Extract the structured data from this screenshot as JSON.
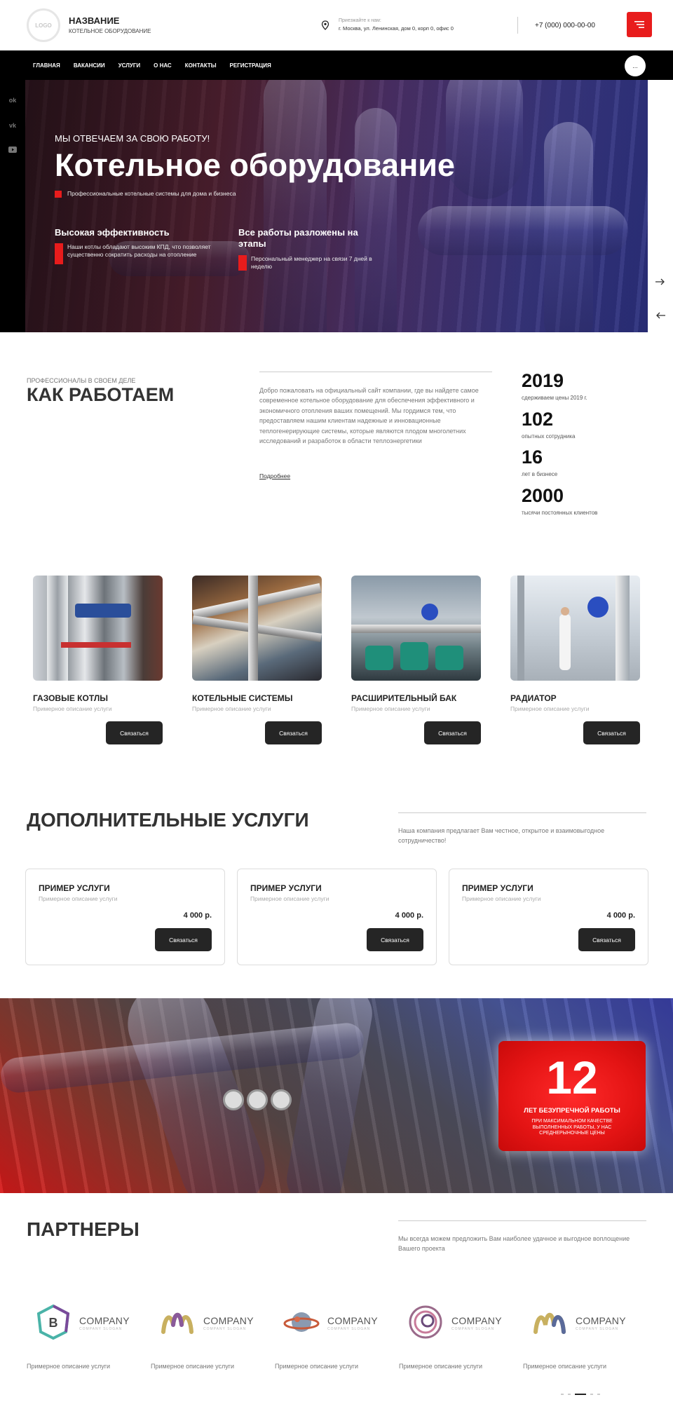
{
  "header": {
    "logo_text": "LOGO",
    "brand_name": "НАЗВАНИЕ",
    "brand_sub": "КОТЕЛЬНОЕ ОБОРУДОВАНИЕ",
    "address_label": "Приезжайте к нам:",
    "address_value": "г. Москва, ул. Ленинская, дом 0, корп 0, офис 0",
    "phone": "+7 (000) 000-00-00"
  },
  "nav": {
    "items": [
      "ГЛАВНАЯ",
      "ВАКАНСИИ",
      "УСЛУГИ",
      "О НАС",
      "КОНТАКТЫ",
      "РЕГИСТРАЦИЯ"
    ],
    "more": "..."
  },
  "social": [
    "ok",
    "vk",
    "youtube"
  ],
  "hero": {
    "tagline": "МЫ ОТВЕЧАЕМ ЗА СВОЮ РАБОТУ!",
    "title": "Котельное оборудование",
    "subtitle": "Профессиональные котельные системы для дома и бизнеса",
    "features": [
      {
        "title": "Высокая эффективность",
        "text": "Наши котлы обладают высоким КПД, что позволяет существенно сократить расходы на отопление"
      },
      {
        "title": "Все работы разложены на этапы",
        "text": "Персональный менеджер на связи 7 дней в неделю"
      }
    ]
  },
  "how": {
    "kicker": "ПРОФЕССИОНАЛЫ В СВОЕМ ДЕЛЕ",
    "title": "КАК РАБОТАЕМ",
    "text": "Добро пожаловать на официальный сайт компании, где вы найдете самое современное котельное оборудование для обеспечения эффективного и экономичного отопления ваших помещений. Мы гордимся тем, что предоставляем нашим клиентам надежные и инновационные теплогенерирующие системы, которые являются плодом многолетних исследований и разработок в области теплоэнергетики",
    "more": "Подробнее",
    "stats": [
      {
        "value": "2019",
        "label": "сдерживаем цены 2019 г."
      },
      {
        "value": "102",
        "label": "опытных сотрудника"
      },
      {
        "value": "16",
        "label": "лет в бизнесе"
      },
      {
        "value": "2000",
        "label": "тысячи постоянных клиентов"
      }
    ]
  },
  "products": [
    {
      "title": "ГАЗОВЫЕ КОТЛЫ",
      "desc": "Примерное описание услуги",
      "button": "Связаться"
    },
    {
      "title": "КОТЕЛЬНЫЕ СИСТЕМЫ",
      "desc": "Примерное описание услуги",
      "button": "Связаться"
    },
    {
      "title": "РАСШИРИТЕЛЬНЫЙ БАК",
      "desc": "Примерное описание услуги",
      "button": "Связаться"
    },
    {
      "title": "РАДИАТОР",
      "desc": "Примерное описание услуги",
      "button": "Связаться"
    }
  ],
  "additional": {
    "title": "ДОПОЛНИТЕЛЬНЫЕ УСЛУГИ",
    "text": "Наша компания предлагает Вам честное, открытое и взаимовыгодное сотрудничество!",
    "cards": [
      {
        "title": "ПРИМЕР УСЛУГИ",
        "desc": "Примерное описание услуги",
        "price": "4 000 р.",
        "button": "Связаться"
      },
      {
        "title": "ПРИМЕР УСЛУГИ",
        "desc": "Примерное описание услуги",
        "price": "4 000 р.",
        "button": "Связаться"
      },
      {
        "title": "ПРИМЕР УСЛУГИ",
        "desc": "Примерное описание услуги",
        "price": "4 000 р.",
        "button": "Связаться"
      }
    ]
  },
  "banner": {
    "number": "12",
    "title": "ЛЕТ БЕЗУПРЕЧНОЙ РАБОТЫ",
    "text": "ПРИ МАКСИМАЛЬНОМ КАЧЕСТВЕ ВЫПОЛНЕННЫХ РАБОТЫ, У НАС СРЕДНЕРЫНОЧНЫЕ ЦЕНЫ"
  },
  "partners": {
    "title": "ПАРТНЕРЫ",
    "text": "Мы всегда можем предложить Вам наиболее удачное и выгодное воплощение Вашего проекта",
    "items": [
      {
        "name": "COMPANY",
        "slogan": "COMPANY SLOGAN",
        "desc": "Примерное описание услуги"
      },
      {
        "name": "COMPANY",
        "slogan": "COMPANY SLOGAN",
        "desc": "Примерное описание услуги"
      },
      {
        "name": "COMPANY",
        "slogan": "COMPANY SLOGAN",
        "desc": "Примерное описание услуги"
      },
      {
        "name": "COMPANY",
        "slogan": "COMPANY SLOGAN",
        "desc": "Примерное описание услуги"
      },
      {
        "name": "COMPANY",
        "slogan": "COMPANY SLOGAN",
        "desc": "Примерное описание услуги"
      }
    ]
  },
  "colors": {
    "accent": "#e81c1c",
    "dark": "#252525",
    "nav": "#000000"
  }
}
